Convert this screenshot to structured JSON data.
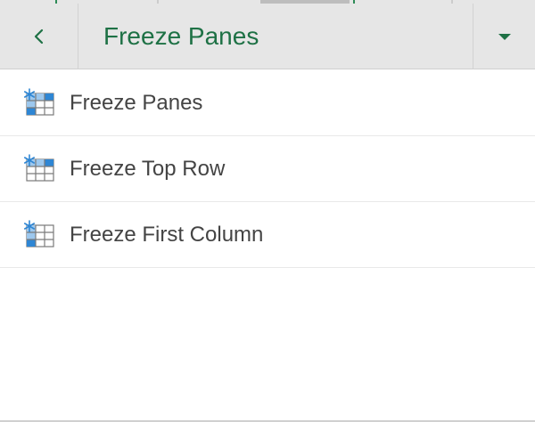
{
  "header": {
    "title": "Freeze Panes",
    "back_icon": "chevron-left-icon",
    "dropdown_icon": "caret-down-icon"
  },
  "menu": {
    "items": [
      {
        "label": "Freeze Panes",
        "icon": "freeze-panes-icon"
      },
      {
        "label": "Freeze Top Row",
        "icon": "freeze-top-row-icon"
      },
      {
        "label": "Freeze First Column",
        "icon": "freeze-first-column-icon"
      }
    ]
  },
  "colors": {
    "accent": "#1e7145",
    "header_bg": "#e6e6e6",
    "icon_blue": "#2e86d4",
    "text": "#444444"
  }
}
